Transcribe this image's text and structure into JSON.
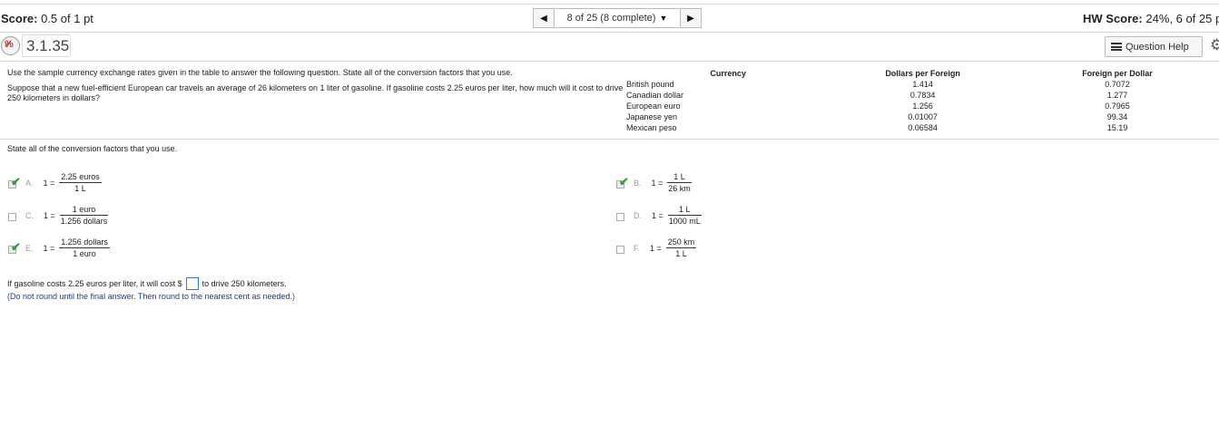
{
  "header": {
    "score_label": "Score:",
    "score_value": "0.5 of 1 pt",
    "nav_text": "8 of 25 (8 complete)",
    "hw_score_label": "HW Score:",
    "hw_score_value": "24%, 6 of 25 p"
  },
  "question": {
    "number": "3.1.35",
    "status_badge": "partial-credit-icon",
    "help_label": "Question Help",
    "intro": "Use the sample currency exchange rates given in the table to answer the following question. State all of the conversion factors that you use.",
    "problem": "Suppose that a new fuel-efficient European car travels an average of 26 kilometers on 1 liter of gasoline. If gasoline costs 2.25 euros per liter, how much will it cost to drive 250 kilometers in dollars?"
  },
  "table": {
    "headers": [
      "Currency",
      "Dollars per Foreign",
      "Foreign per Dollar"
    ],
    "rows": [
      [
        "British pound",
        "1.414",
        "0.7072"
      ],
      [
        "Canadian dollar",
        "0.7834",
        "1.277"
      ],
      [
        "European euro",
        "1.256",
        "0.7965"
      ],
      [
        "Japanese yen",
        "0.01007",
        "99.34"
      ],
      [
        "Mexican peso",
        "0.06584",
        "15.19"
      ]
    ]
  },
  "instruction": "State all of the conversion factors that you use.",
  "options": {
    "A": {
      "letter": "A.",
      "lhs": "1 =",
      "num": "2.25 euros",
      "den": "1 L",
      "checked": true
    },
    "B": {
      "letter": "B.",
      "lhs": "1 =",
      "num": "1 L",
      "den": "26 km",
      "checked": true
    },
    "C": {
      "letter": "C.",
      "lhs": "1 =",
      "num": "1 euro",
      "den": "1.256 dollars",
      "checked": false
    },
    "D": {
      "letter": "D.",
      "lhs": "1 =",
      "num": "1 L",
      "den": "1000 mL",
      "checked": false
    },
    "E": {
      "letter": "E.",
      "lhs": "1 =",
      "num": "1.256 dollars",
      "den": "1 euro",
      "checked": true
    },
    "F": {
      "letter": "F.",
      "lhs": "1 =",
      "num": "250 km",
      "den": "1 L",
      "checked": false
    }
  },
  "answer": {
    "prefix": "If gasoline costs 2.25 euros per liter, it will cost $",
    "value": "",
    "suffix": "to drive 250 kilometers.",
    "note": "(Do not round until the final answer. Then round to the nearest cent as needed.)"
  },
  "colors": {
    "accent_blue": "#2a7fd4",
    "check_green": "#3a9a3a",
    "note_blue": "#1a3c8a"
  }
}
